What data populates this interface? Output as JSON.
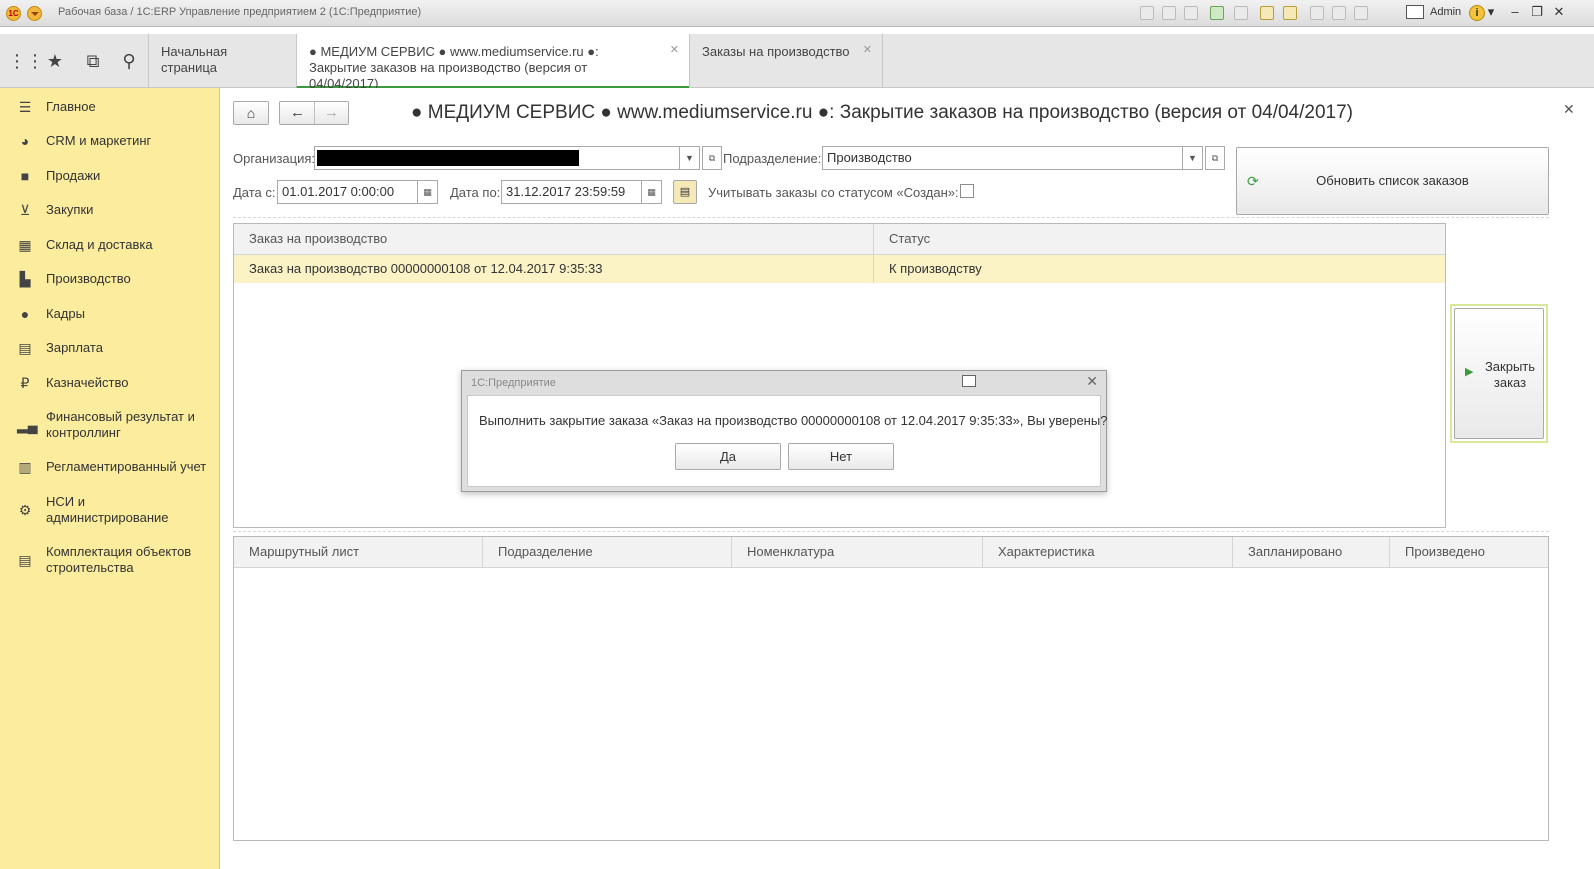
{
  "titlebar": {
    "title": "Рабочая база / 1С:ERP Управление предприятием 2  (1С:Предприятие)",
    "logo": "1С",
    "user": "Admin",
    "info_icon": "i"
  },
  "tabs": [
    {
      "label": "Начальная страница"
    },
    {
      "label": "● МЕДИУМ СЕРВИС ● www.mediumservice.ru ●: Закрытие заказов на производство (версия от 04/04/2017)"
    },
    {
      "label": "Заказы на производство"
    }
  ],
  "sidebar": {
    "items": [
      {
        "label": "Главное",
        "icon": "hamburger-icon"
      },
      {
        "label": "CRM и маркетинг",
        "icon": "pie-chart-icon"
      },
      {
        "label": "Продажи",
        "icon": "bag-icon"
      },
      {
        "label": "Закупки",
        "icon": "cart-icon"
      },
      {
        "label": "Склад и доставка",
        "icon": "warehouse-icon"
      },
      {
        "label": "Производство",
        "icon": "factory-icon"
      },
      {
        "label": "Кадры",
        "icon": "people-icon"
      },
      {
        "label": "Зарплата",
        "icon": "calculator-icon"
      },
      {
        "label": "Казначейство",
        "icon": "ruble-icon"
      },
      {
        "label": "Финансовый результат и контроллинг",
        "icon": "bar-chart-icon"
      },
      {
        "label": "Регламентированный учет",
        "icon": "document-icon"
      },
      {
        "label": "НСИ и администрирование",
        "icon": "gear-icon"
      },
      {
        "label": "Комплектация объектов строительства",
        "icon": "building-icon"
      }
    ]
  },
  "form": {
    "title": "● МЕДИУМ СЕРВИС ● www.mediumservice.ru ●: Закрытие заказов на производство (версия от 04/04/2017)",
    "org_label": "Организация:",
    "org_value": "",
    "dept_label": "Подразделение:",
    "dept_value": "Производство",
    "date_from_label": "Дата с:",
    "date_from_value": "01.01.2017  0:00:00",
    "date_to_label": "Дата по:",
    "date_to_value": "31.12.2017 23:59:59",
    "created_status_label": "Учитывать заказы со статусом «Создан»:",
    "refresh_label": "Обновить список заказов",
    "close_order_label": "Закрыть заказ"
  },
  "orders": {
    "columns": [
      "Заказ на производство",
      "Статус"
    ],
    "rows": [
      {
        "order": "Заказ на производство 00000000108 от 12.04.2017 9:35:33",
        "status": "К производству"
      }
    ]
  },
  "routes": {
    "columns": [
      "Маршрутный лист",
      "Подразделение",
      "Номенклатура",
      "Характеристика",
      "Запланировано",
      "Произведено"
    ]
  },
  "dialog": {
    "title": "1С:Предприятие",
    "message": "Выполнить закрытие заказа «Заказ на производство 00000000108 от 12.04.2017 9:35:33», Вы уверены?",
    "yes": "Да",
    "no": "Нет"
  },
  "colors": {
    "sidebar_bg": "#fbec9e",
    "selected_row": "#fbf3c6",
    "active_tab_accent": "#3b9a3b"
  }
}
